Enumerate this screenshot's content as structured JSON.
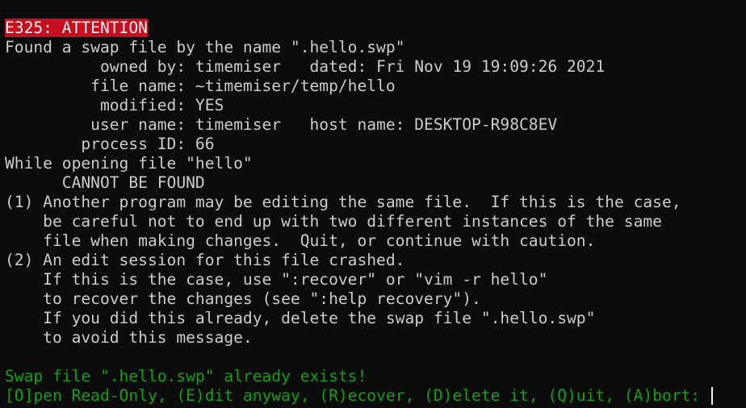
{
  "error": {
    "code_label": "E325: ATTENTION"
  },
  "body_lines": [
    "Found a swap file by the name \".hello.swp\"",
    "          owned by: timemiser   dated: Fri Nov 19 19:09:26 2021",
    "         file name: ~timemiser/temp/hello",
    "          modified: YES",
    "         user name: timemiser   host name: DESKTOP-R98C8EV",
    "        process ID: 66",
    "While opening file \"hello\"",
    "      CANNOT BE FOUND",
    "(1) Another program may be editing the same file.  If this is the case,",
    "    be careful not to end up with two different instances of the same",
    "    file when making changes.  Quit, or continue with caution.",
    "(2) An edit session for this file crashed.",
    "    If this is the case, use \":recover\" or \"vim -r hello\"",
    "    to recover the changes (see \":help recovery\").",
    "    If you did this already, delete the swap file \".hello.swp\"",
    "    to avoid this message.",
    ""
  ],
  "prompt": {
    "exists_message": "Swap file \".hello.swp\" already exists!",
    "choices": "[O]pen Read-Only, (E)dit anyway, (R)ecover, (D)elete it, (Q)uit, (A)bort: "
  },
  "colors": {
    "background": "#0c0c0c",
    "text": "#cccccc",
    "error_background": "#c50f1f",
    "prompt_green": "#13a10e"
  }
}
